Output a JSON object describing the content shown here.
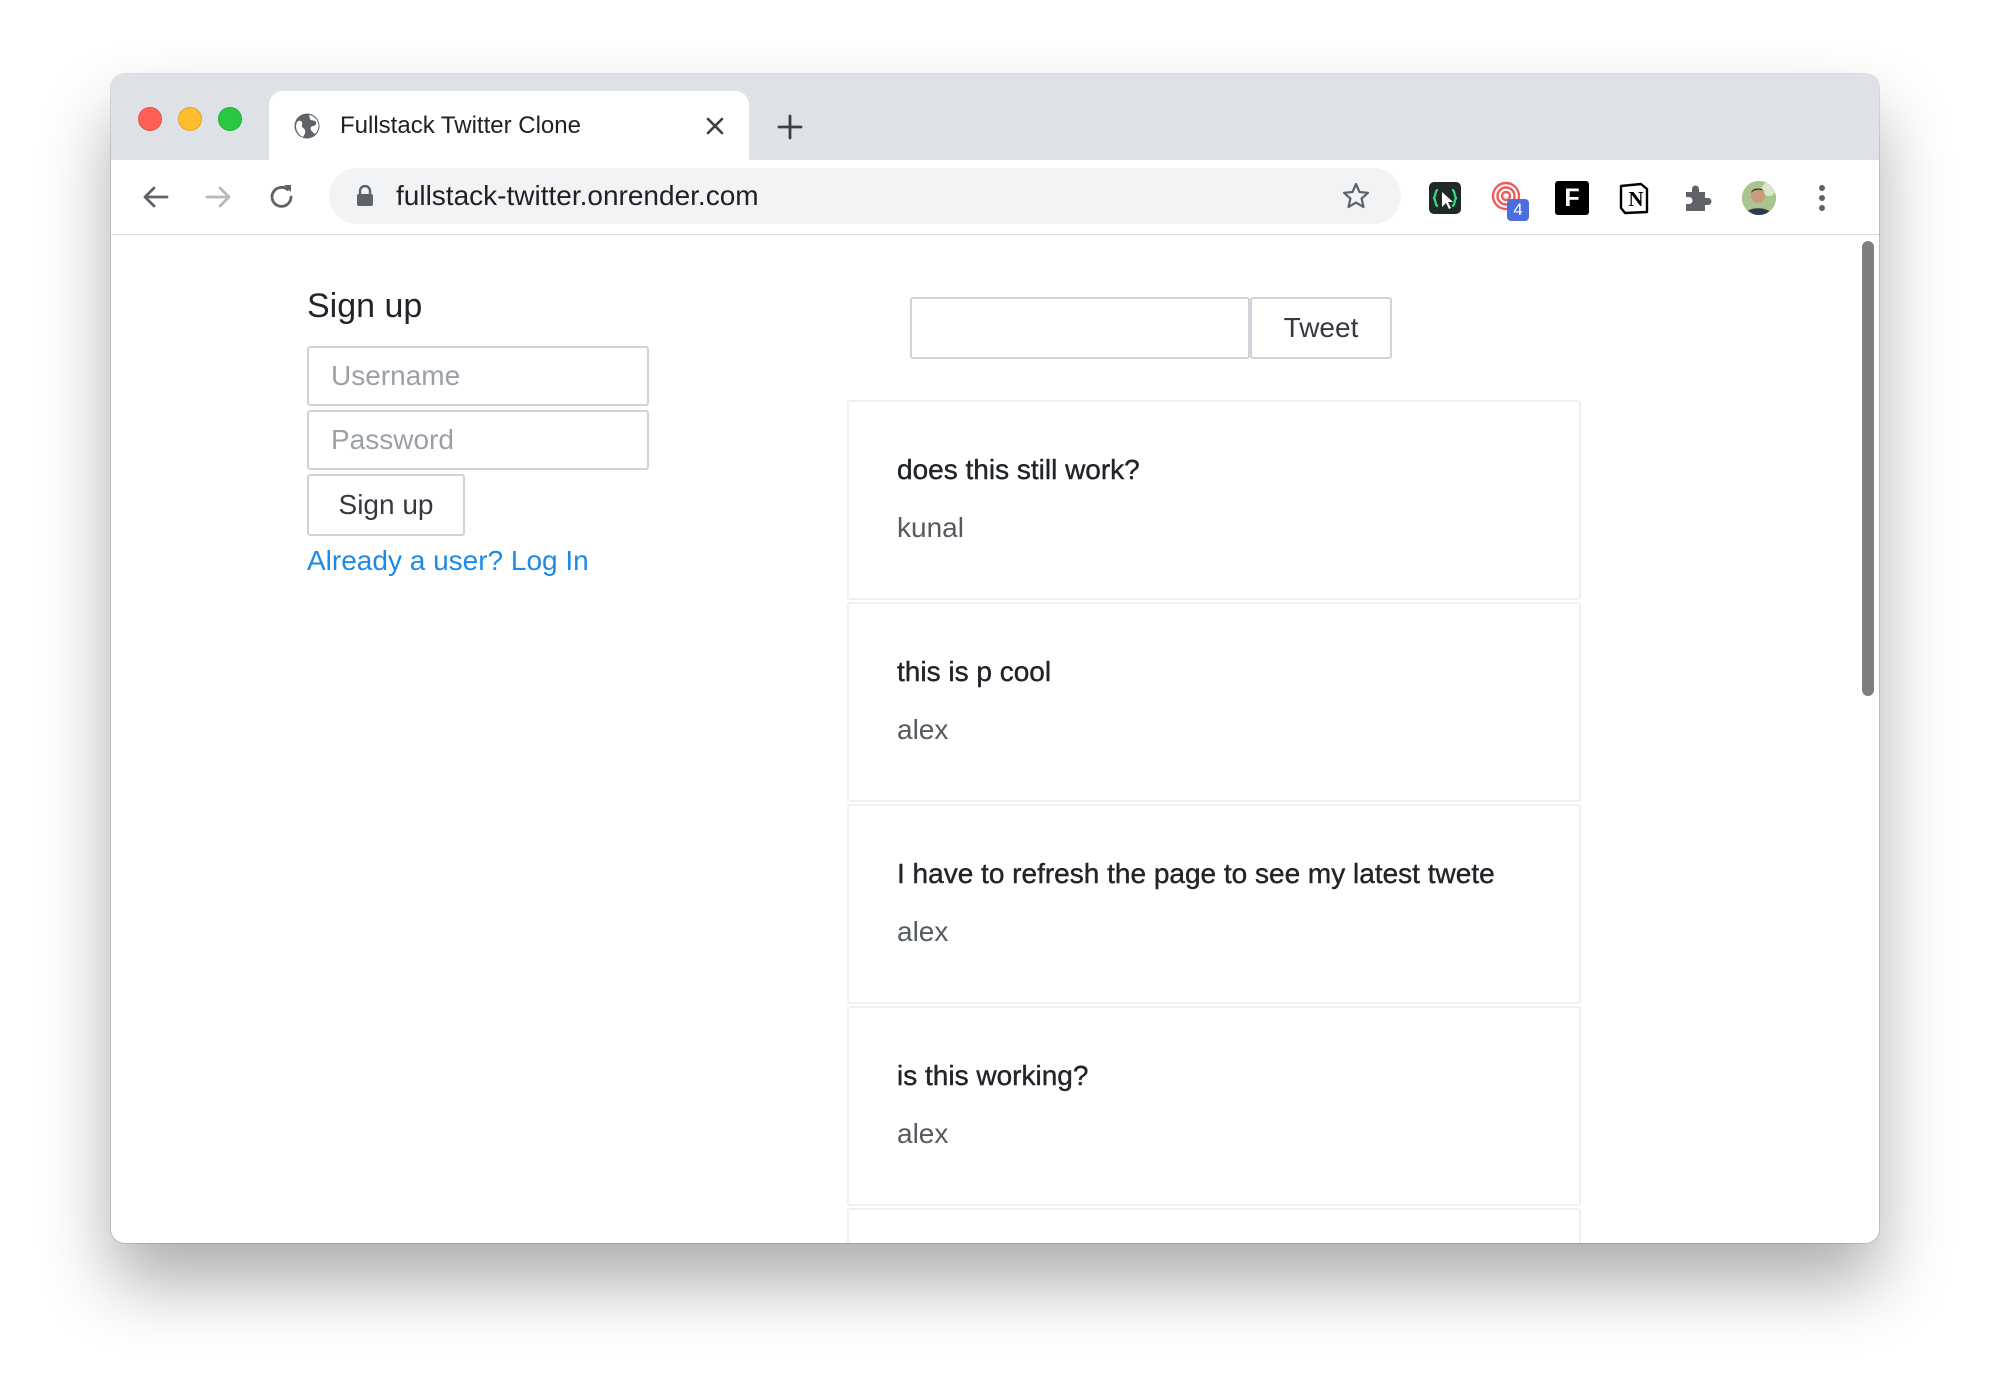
{
  "browser": {
    "tab_title": "Fullstack Twitter Clone",
    "url": "fullstack-twitter.onrender.com",
    "extensions": [
      {
        "icon": "tweet-hunter-icon"
      },
      {
        "icon": "spiral-extension-icon",
        "badge": "4"
      },
      {
        "icon": "f-extension-icon",
        "label": "F"
      },
      {
        "icon": "notion-icon",
        "label": "N"
      },
      {
        "icon": "puzzle-extensions-icon"
      },
      {
        "icon": "profile-avatar"
      }
    ],
    "colors": {
      "tabbar": "#dee1e6",
      "omnibox": "#f1f3f4",
      "badge": "#4a6fdc"
    }
  },
  "signup": {
    "heading": "Sign up",
    "username_placeholder": "Username",
    "password_placeholder": "Password",
    "button_label": "Sign up",
    "login_link": "Already a user? Log In"
  },
  "composer": {
    "tweet_value": "",
    "tweet_button": "Tweet"
  },
  "feed": {
    "tweets": [
      {
        "message": "does this still work?",
        "user": "kunal"
      },
      {
        "message": "this is p cool",
        "user": "alex"
      },
      {
        "message": "I have to refresh the page to see my latest twete",
        "user": "alex"
      },
      {
        "message": "is this working?",
        "user": "alex"
      }
    ]
  },
  "theme": {
    "link": "#1d8ae6",
    "text": "#212529",
    "border": "#ced4da"
  }
}
